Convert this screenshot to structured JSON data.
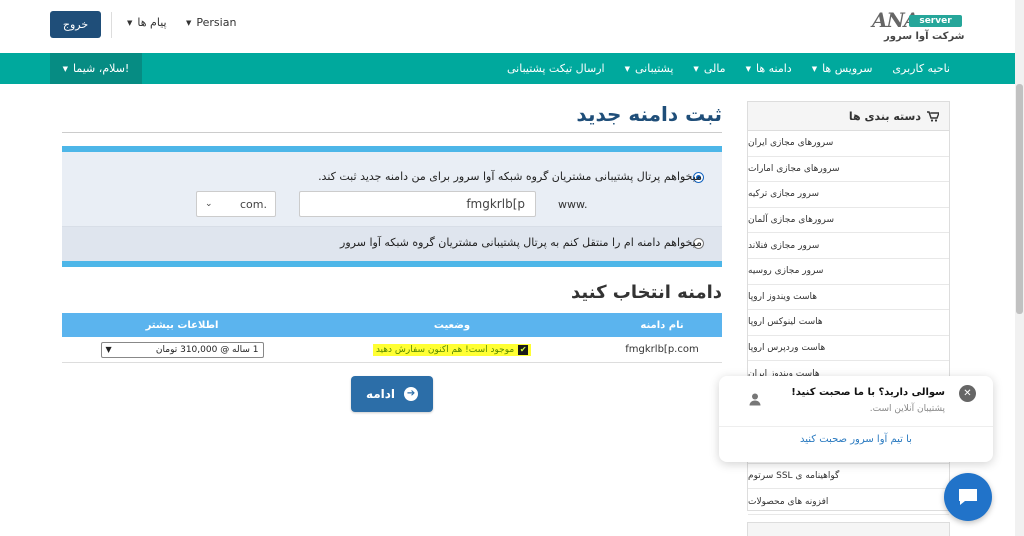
{
  "header": {
    "logout_label": "خروج",
    "messages_label": "پیام ها",
    "language_label": "Persian",
    "logo_brand": "ANA",
    "logo_server": "server",
    "logo_subtitle": "شرکت آوا سرور"
  },
  "navbar": {
    "greeting": "سلام، شیما!",
    "items": [
      {
        "label": "ناحیه کاربری"
      },
      {
        "label": "سرویس ها"
      },
      {
        "label": "دامنه ها"
      },
      {
        "label": "مالی"
      },
      {
        "label": "پشتیبانی"
      },
      {
        "label": "ارسال تیکت پشتیبانی"
      }
    ]
  },
  "sidebar": {
    "title": "دسته بندی ها",
    "items": [
      "سرورهای مجازی ایران",
      "سرورهای مجازی امارات",
      "سرور مجازی ترکیه",
      "سرورهای مجازی آلمان",
      "سرور مجازی فنلاند",
      "سرور مجازی روسیه",
      "هاست ویندوز اروپا",
      "هاست لینوکس اروپا",
      "هاست وردپرس اروپا",
      "هاست ویندوز ایران",
      "",
      "",
      "",
      "گواهینامه ی SSL سرتوم",
      "افزونه های محصولات"
    ]
  },
  "main": {
    "page_title": "ثبت دامنه جدید",
    "option_register": "میخواهم پرتال پشتیبانی مشتریان گروه شبکه آوا سرور برای من دامنه جدید ثبت کند.",
    "domain_value": "fmgkrlb[p",
    "www_prefix": "www.",
    "tld_value": "com.",
    "option_transfer": "میخواهم دامنه ام را منتقل کنم به پرتال پشتیبانی مشتریان گروه شبکه آوا سرور",
    "section_title": "دامنه انتخاب کنید",
    "table": {
      "headers": {
        "name": "نام دامنه",
        "status": "وضعیت",
        "info": "اطلاعات بیشتر"
      },
      "row": {
        "name": "fmgkrlb[p.com",
        "status": "موجود است! هم اکنون سفارش دهید",
        "period": "1 ساله @ 310,000 تومان"
      }
    },
    "continue_label": "ادامه"
  },
  "chat": {
    "title": "سوالی دارید؟ با ما صحبت کنید!",
    "subtitle": "پشتیبان آنلاین است.",
    "link": "با تیم آوا سرور صحبت کنید"
  },
  "colors": {
    "navbar": "#00a99d",
    "primary_dark": "#1f4e79",
    "panel_border": "#4db6e8",
    "table_header": "#5bb4ee",
    "highlight": "#ffff33",
    "chat_bubble": "#2173c9"
  }
}
